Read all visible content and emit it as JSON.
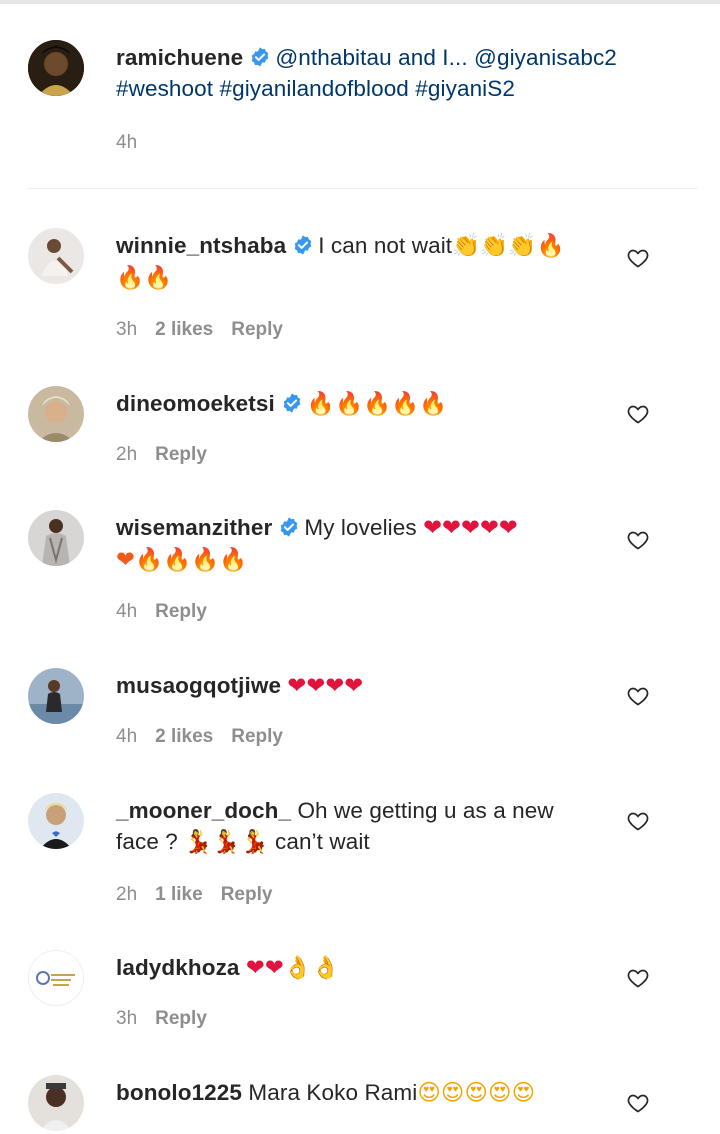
{
  "caption": {
    "username": "ramichuene",
    "text_mentions": "@nthabitau and I... @giyanisabc2",
    "text_tags": "#weshoot #giyanilandofblood #giyaniS2",
    "time": "4h"
  },
  "comments": [
    {
      "username": "winnie_ntshaba",
      "verified": true,
      "text": "I can not wait",
      "emoji_line1": "👏👏👏🔥",
      "emoji_line2": "🔥🔥",
      "time": "3h",
      "likes": "2 likes",
      "reply": "Reply"
    },
    {
      "username": "dineomoeketsi",
      "verified": true,
      "text": "",
      "emoji_line1": "🔥🔥🔥🔥🔥",
      "time": "2h",
      "likes": "",
      "reply": "Reply"
    },
    {
      "username": "wisemanzither",
      "verified": true,
      "text": "My lovelies",
      "emoji_line1": "❤❤❤❤❤",
      "emoji_line2": "❤🔥🔥🔥🔥",
      "time": "4h",
      "likes": "",
      "reply": "Reply"
    },
    {
      "username": "musaogqotjiwe",
      "verified": false,
      "text": "",
      "emoji_line1": "❤❤❤❤",
      "time": "4h",
      "likes": "2 likes",
      "reply": "Reply"
    },
    {
      "username": "_mooner_doch_",
      "verified": false,
      "text": "Oh we getting u as a new",
      "text_line2_start": "face ?",
      "emoji_line2": "💃💃💃",
      "text_line2_end": "can’t wait",
      "time": "2h",
      "likes": "1 like",
      "reply": "Reply"
    },
    {
      "username": "ladydkhoza",
      "verified": false,
      "text": "",
      "emoji_line1": "❤❤👌👌",
      "time": "3h",
      "likes": "",
      "reply": "Reply"
    },
    {
      "username": "bonolo1225",
      "verified": false,
      "text": "Mara Koko Rami",
      "emoji_line1": "😍😍😍😍😍",
      "time": "",
      "likes": "",
      "reply": ""
    }
  ],
  "colors": {
    "accent_link": "#00376b",
    "verified_blue": "#3897f0",
    "meta_gray": "#8e8e8e"
  },
  "icons": {
    "like": "heart-outline-icon",
    "verified": "verified-badge-icon"
  }
}
